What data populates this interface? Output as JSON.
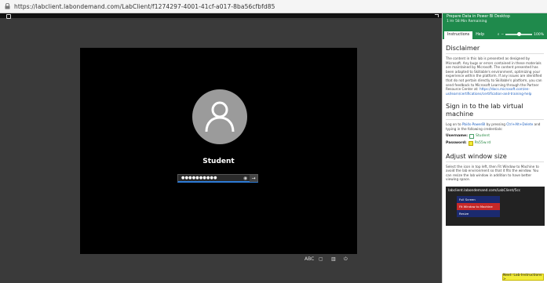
{
  "browser": {
    "url": "https://labclient.labondemand.com/LabClient/f1274297-4001-41cf-a017-8ba56cfbfd85"
  },
  "vm": {
    "user_name": "Student",
    "password_mask": "●●●●●●●●●●",
    "controls": {
      "ctrl_alt_del_label": "ABC"
    }
  },
  "panel": {
    "title": "Prepare Data in Power BI Desktop",
    "time_remaining": "1 Hr 58 Min Remaining",
    "tabs": [
      {
        "label": "Instructions"
      },
      {
        "label": "Help"
      }
    ],
    "zoom_label": "100%",
    "zoom_level": 0.45,
    "sections": {
      "disclaimer": {
        "heading": "Disclaimer",
        "body": "The content in this lab is presented as designed by Microsoft. Any bugs or errors contained in these materials are maintained by Microsoft. The content presented has been adapted to Skillable's environment, optimizing your experience within the platform. If any issues are identified that do not pertain directly to Skillable's platform, you can send feedback to Microsoft Learning through the Partner Resource Center at:",
        "link": "https://docs.microsoft.com/en-us/learn/certifications/certification-and-training-help"
      },
      "signin": {
        "heading": "Sign in to the lab virtual machine",
        "body_prefix": "Log on to",
        "body_vm": "Pbi4s-PowerBI",
        "body_mid": "by pressing",
        "body_keys": "Ctrl+Alt+Delete",
        "body_suffix": "and typing in the following credentials:",
        "username_label": "Username:",
        "username_value": "Student",
        "password_label": "Password:",
        "password_value": "Pa55w.rd"
      },
      "adjust": {
        "heading": "Adjust window size",
        "body": "Select the icon in top left, then Fit Window to Machine to avoid the lab environment so that it fits the window. You can resize the lab window in addition to have better viewing space.",
        "thumb_url": "labclient.labondemand.com/LabClient/5cc",
        "menu_items": [
          "Full Screen",
          "Fit Window to Machine",
          "Resize"
        ]
      }
    },
    "next_button_label": "Next: Lab Instructions >"
  }
}
